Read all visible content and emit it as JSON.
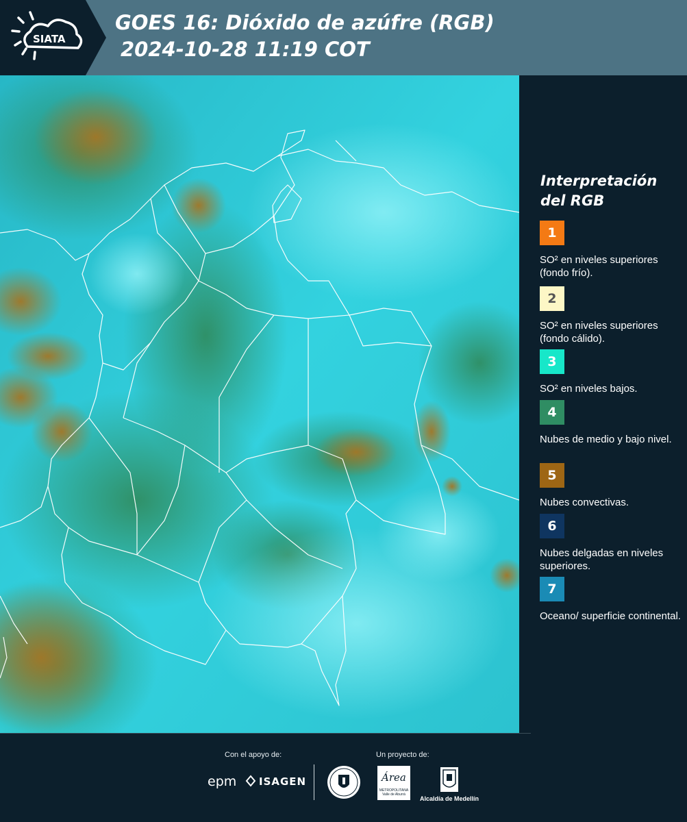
{
  "header": {
    "logo_text": "SIATA",
    "title_line1": "GOES 16: Dióxido de azúfre (RGB)",
    "title_line2": "2024-10-28 11:19 COT",
    "background_color": "#4d7384",
    "logo_panel_color": "#0c1f2c"
  },
  "map": {
    "description_icon": "satellite-rgb-map",
    "palette": {
      "ocean_surface": "#20c6d6",
      "land_clouds_low": "#3a8f6a",
      "convective": "#9b7a2a",
      "border_lines": "#ffffff"
    }
  },
  "legend": {
    "title_line1": "Interpretación",
    "title_line2": "del RGB",
    "items": [
      {
        "number": "1",
        "color": "#f47a14",
        "text": "SO² en niveles superiores (fondo frío).",
        "number_color": "#ffffff"
      },
      {
        "number": "2",
        "color": "#fdf7c6",
        "text": "SO² en niveles superiores (fondo cálido).",
        "number_color": "#555555"
      },
      {
        "number": "3",
        "color": "#17e7c9",
        "text": "SO² en niveles bajos.",
        "number_color": "#ffffff"
      },
      {
        "number": "4",
        "color": "#2f8d63",
        "text": "Nubes de medio y bajo nivel.",
        "number_color": "#ffffff"
      },
      {
        "number": "5",
        "color": "#9e6614",
        "text": "Nubes convectivas.",
        "number_color": "#ffffff"
      },
      {
        "number": "6",
        "color": "#0f3560",
        "text": "Nubes delgadas en niveles superiores.",
        "number_color": "#ffffff"
      },
      {
        "number": "7",
        "color": "#1a8bb5",
        "text": "Oceano/ superficie continental.",
        "number_color": "#ffffff"
      }
    ]
  },
  "footer": {
    "support_label": "Con el apoyo de:",
    "project_label": "Un proyecto de:",
    "sponsor_1": "epm",
    "sponsor_2": "ISAGEN",
    "area_logo_word": "Área",
    "area_logo_sub": "METROPOLITANA Valle de Aburrá",
    "alcaldia_label": "Alcaldía de Medellín"
  }
}
